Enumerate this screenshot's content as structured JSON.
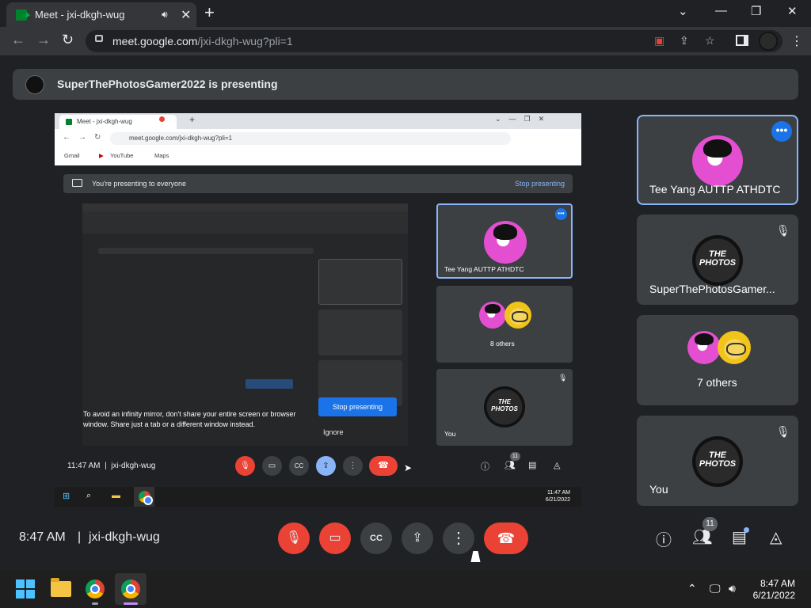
{
  "browser": {
    "tab_title": "Meet - jxi-dkgh-wug",
    "tab_audio_icon": "speaker-icon",
    "tab_close": "✕",
    "new_tab": "+",
    "window_minimize": "—",
    "window_restore": "❐",
    "window_close": "✕",
    "tab_list": "⌄",
    "url_host": "meet.google.com",
    "url_path": "/jxi-dkgh-wug?pli=1"
  },
  "presenting_banner": {
    "text": "SuperThePhotosGamer2022 is presenting"
  },
  "shared_screen": {
    "tab_title": "Meet - jxi-dkgh-wug",
    "url": "meet.google.com/jxi-dkgh-wug?pli=1",
    "bookmarks": [
      "Gmail",
      "YouTube",
      "Maps"
    ],
    "banner_text": "You're presenting to everyone",
    "banner_stop": "Stop presenting",
    "mirror_warning": "To avoid an infinity mirror, don't share your entire screen or browser window. Share just a tab or a different window instead.",
    "stop_button": "Stop presenting",
    "ignore_button": "Ignore",
    "tiles": [
      {
        "name": "Tee Yang AUTTP ATHDTC"
      },
      {
        "name": "8 others"
      },
      {
        "name": "You"
      }
    ],
    "time": "11:47 AM",
    "meeting_code": "jxi-dkgh-wug",
    "people_count": "11",
    "tray_time": "11:47 AM",
    "tray_date": "6/21/2022"
  },
  "tiles": [
    {
      "name": "Tee Yang AUTTP ATHDTC",
      "avatar": "pink-avatar",
      "more": "•••"
    },
    {
      "name": "SuperThePhotosGamer...",
      "avatar": "the-photos-avatar"
    },
    {
      "name": "7 others",
      "avatar": "group-avatar"
    },
    {
      "name": "You",
      "avatar": "the-photos-avatar"
    }
  ],
  "avatar_text": {
    "line1": "THE",
    "line2": "PHOTOS"
  },
  "meeting": {
    "time": "8:47 AM",
    "separator": "|",
    "code": "jxi-dkgh-wug",
    "people_count": "11"
  },
  "taskbar": {
    "time": "8:47 AM",
    "date": "6/21/2022"
  },
  "colors": {
    "accent": "#8ab4f8",
    "danger": "#ea4335",
    "surface": "#3c4043",
    "background": "#202124"
  }
}
